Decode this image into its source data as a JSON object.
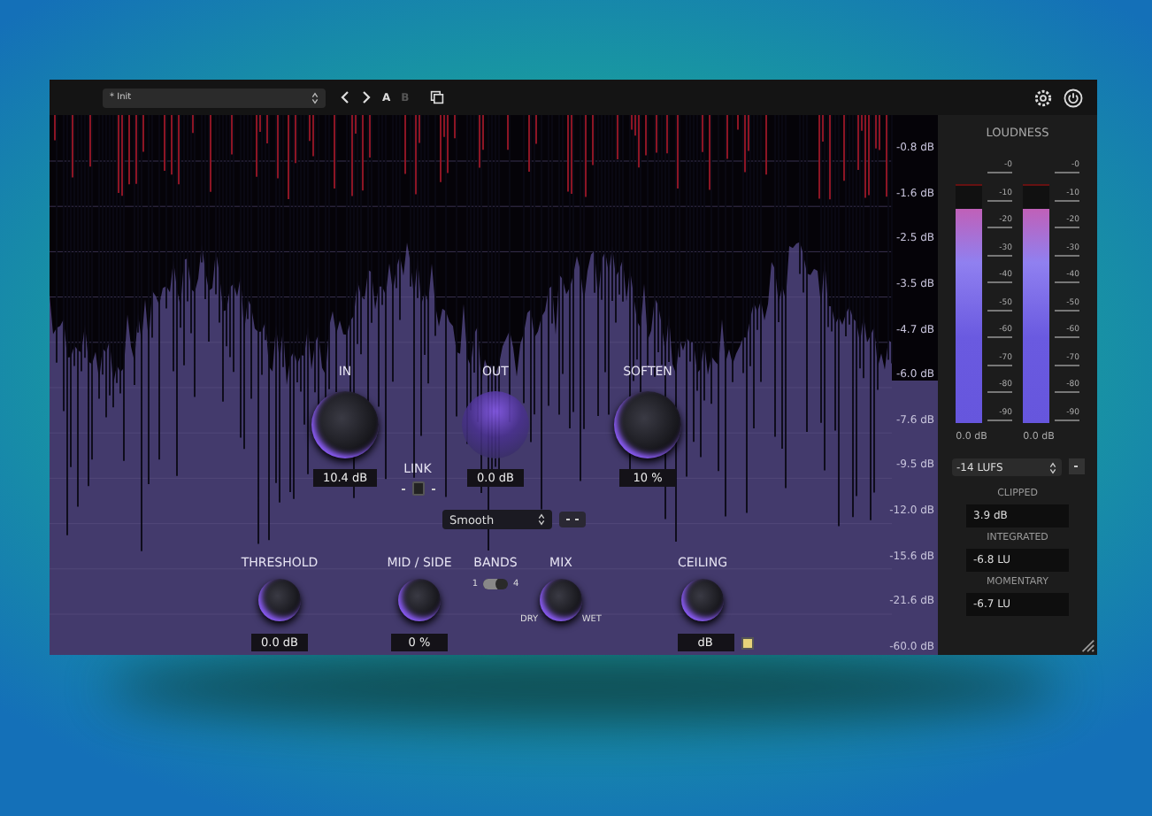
{
  "toolbar": {
    "preset": "* Init",
    "ab_buttons": [
      {
        "label": "A",
        "selected": true
      },
      {
        "label": "B",
        "selected": false
      }
    ]
  },
  "display": {
    "scale_labels": [
      "-0.8 dB",
      "-1.6 dB",
      "-2.5 dB",
      "-3.5 dB",
      "-4.7 dB",
      "-6.0 dB",
      "-7.6 dB",
      "-9.5 dB",
      "-12.0 dB",
      "-15.6 dB",
      "-21.6 dB",
      "-60.0 dB"
    ]
  },
  "main_knobs": [
    {
      "label": "IN",
      "value": "10.4 dB",
      "kind": "solid"
    },
    {
      "label": "OUT",
      "value": "0.0 dB",
      "kind": "glow"
    },
    {
      "label": "SOFTEN",
      "value": "10 %",
      "kind": "solid"
    }
  ],
  "link": {
    "label": "LINK"
  },
  "mode_select": {
    "value": "Smooth"
  },
  "bottom_controls": [
    {
      "kind": "knob",
      "label": "THRESHOLD",
      "value": "0.0 dB"
    },
    {
      "kind": "knob",
      "label": "MID / SIDE",
      "value": "0 %"
    },
    {
      "kind": "switch",
      "label": "BANDS",
      "min_label": "1",
      "max_label": "4",
      "on": false
    },
    {
      "kind": "knob",
      "label": "MIX",
      "min_label": "DRY",
      "max_label": "WET"
    },
    {
      "kind": "knob",
      "label": "CEILING",
      "value": "dB"
    }
  ],
  "loudness": {
    "title": "LOUDNESS",
    "meters": [
      {
        "level": 0.9,
        "peak": "0.0 dB",
        "ticks": [
          "-0",
          "-10",
          "-20",
          "-30",
          "-40",
          "-50",
          "-60",
          "-70",
          "-80",
          "-90"
        ]
      },
      {
        "level": 0.9,
        "peak": "0.0 dB",
        "ticks": [
          "-0",
          "-10",
          "-20",
          "-30",
          "-40",
          "-50",
          "-60",
          "-70",
          "-80",
          "-90"
        ]
      }
    ],
    "target": "-14 LUFS",
    "readouts": [
      {
        "label": "CLIPPED",
        "value": "3.9 dB"
      },
      {
        "label": "INTEGRATED",
        "value": "-6.8 LU"
      },
      {
        "label": "MOMENTARY",
        "value": "-6.7 LU"
      }
    ]
  }
}
